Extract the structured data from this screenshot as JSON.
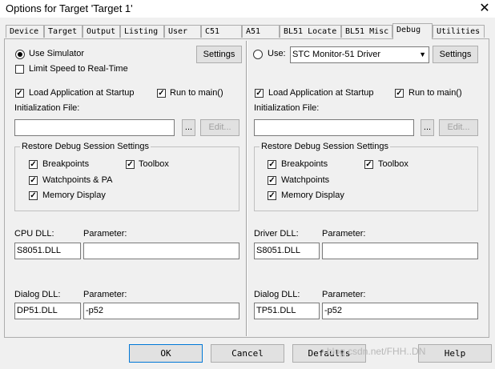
{
  "window": {
    "title": "Options for Target 'Target 1'",
    "close_glyph": "✕"
  },
  "tabs": [
    "Device",
    "Target",
    "Output",
    "Listing",
    "User",
    "C51",
    "A51",
    "BL51 Locate",
    "BL51 Misc",
    "Debug",
    "Utilities"
  ],
  "active_tab": "Debug",
  "left": {
    "use_simulator": "Use Simulator",
    "limit_speed": "Limit Speed to Real-Time",
    "settings": "Settings",
    "load_app": "Load Application at Startup",
    "run_to_main": "Run to main()",
    "init_file_label": "Initialization File:",
    "init_file_value": "",
    "browse": "...",
    "edit": "Edit...",
    "restore_group": "Restore Debug Session Settings",
    "breakpoints": "Breakpoints",
    "toolbox": "Toolbox",
    "watchpoints": "Watchpoints & PA",
    "memory_display": "Memory Display",
    "cpu_dll_label": "CPU DLL:",
    "cpu_dll_param_label": "Parameter:",
    "cpu_dll_value": "S8051.DLL",
    "cpu_dll_param": "",
    "dialog_dll_label": "Dialog DLL:",
    "dialog_dll_param_label": "Parameter:",
    "dialog_dll_value": "DP51.DLL",
    "dialog_dll_param": "-p52"
  },
  "right": {
    "use": "Use:",
    "driver_selected": "STC Monitor-51 Driver",
    "settings": "Settings",
    "load_app": "Load Application at Startup",
    "run_to_main": "Run to main()",
    "init_file_label": "Initialization File:",
    "init_file_value": "",
    "browse": "...",
    "edit": "Edit...",
    "restore_group": "Restore Debug Session Settings",
    "breakpoints": "Breakpoints",
    "toolbox": "Toolbox",
    "watchpoints": "Watchpoints",
    "memory_display": "Memory Display",
    "driver_dll_label": "Driver DLL:",
    "driver_dll_param_label": "Parameter:",
    "driver_dll_value": "S8051.DLL",
    "driver_dll_param": "",
    "dialog_dll_label": "Dialog DLL:",
    "dialog_dll_param_label": "Parameter:",
    "dialog_dll_value": "TP51.DLL",
    "dialog_dll_param": "-p52"
  },
  "footer": {
    "ok": "OK",
    "cancel": "Cancel",
    "defaults": "Defaults",
    "help": "Help"
  },
  "checked_glyph": "✓",
  "watermark": "blog.csdn.net/FHH..DN"
}
